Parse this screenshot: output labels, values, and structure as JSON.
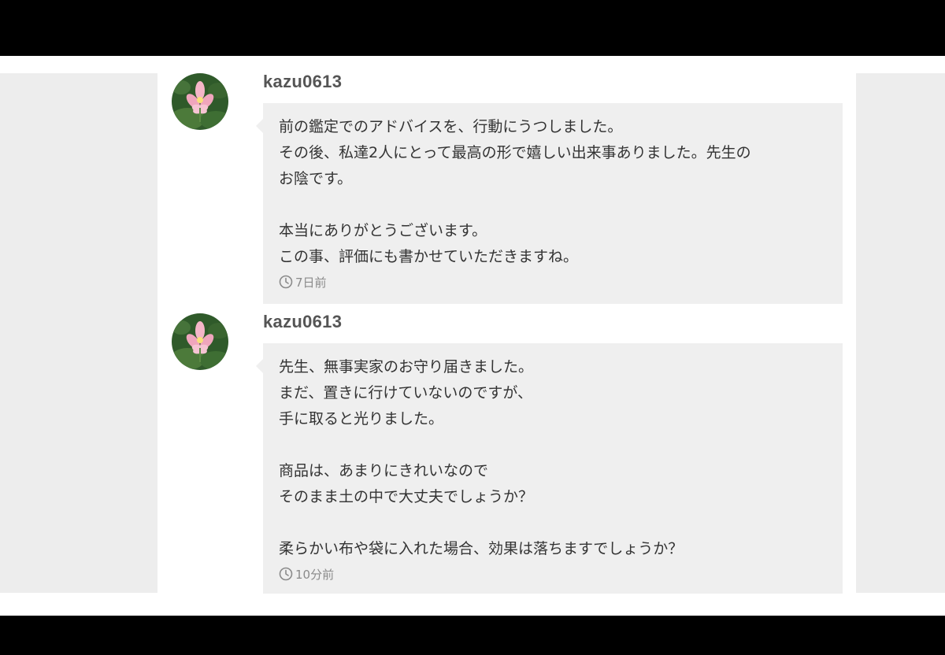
{
  "messages": [
    {
      "username": "kazu0613",
      "avatar": "lotus-flower-image",
      "lines": [
        "前の鑑定でのアドバイスを、行動にうつしました。",
        "その後、私達2人にとって最高の形で嬉しい出来事ありました。先生の",
        "お陰です。",
        "",
        "本当にありがとうございます。",
        "この事、評価にも書かせていただきますね。"
      ],
      "time": "7日前"
    },
    {
      "username": "kazu0613",
      "avatar": "lotus-flower-image",
      "lines": [
        "先生、無事実家のお守り届きました。",
        "まだ、置きに行けていないのですが、",
        "手に取ると光りました。",
        "",
        "商品は、あまりにきれいなので",
        "そのまま土の中で大丈夫でしょうか？",
        "",
        "柔らかい布や袋に入れた場合、効果は落ちますでしょうか？"
      ],
      "time": "10分前"
    }
  ],
  "icons": {
    "clock": "clock-icon"
  },
  "colors": {
    "bubble_bg": "#efefef",
    "side_panel_bg": "#ededed",
    "username": "#555555",
    "text": "#333333",
    "time": "#8a8a8a"
  }
}
